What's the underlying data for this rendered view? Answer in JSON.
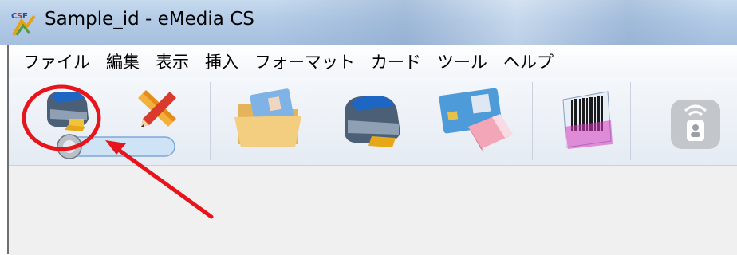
{
  "window": {
    "title": "Sample_id - eMedia CS",
    "logo_icon": "emedia-cs-logo-icon"
  },
  "menubar": {
    "items": [
      {
        "label": "ファイル"
      },
      {
        "label": "編集"
      },
      {
        "label": "表示"
      },
      {
        "label": "挿入"
      },
      {
        "label": "フォーマット"
      },
      {
        "label": "カード"
      },
      {
        "label": "ツール"
      },
      {
        "label": "ヘルプ"
      }
    ]
  },
  "toolbar": {
    "buttons": [
      {
        "icon": "printer-icon"
      },
      {
        "icon": "pencil-ruler-icon"
      },
      {
        "icon": "printer-toggle-slider-icon"
      },
      {
        "icon": "open-folder-icon"
      },
      {
        "icon": "print-card-icon"
      },
      {
        "icon": "card-eraser-icon"
      },
      {
        "icon": "barcode-icon"
      },
      {
        "icon": "contactless-encode-icon"
      }
    ]
  },
  "annotation": {
    "highlight_color": "#e8141b",
    "description_icons": [
      "red-circle-highlight",
      "red-arrow"
    ]
  }
}
